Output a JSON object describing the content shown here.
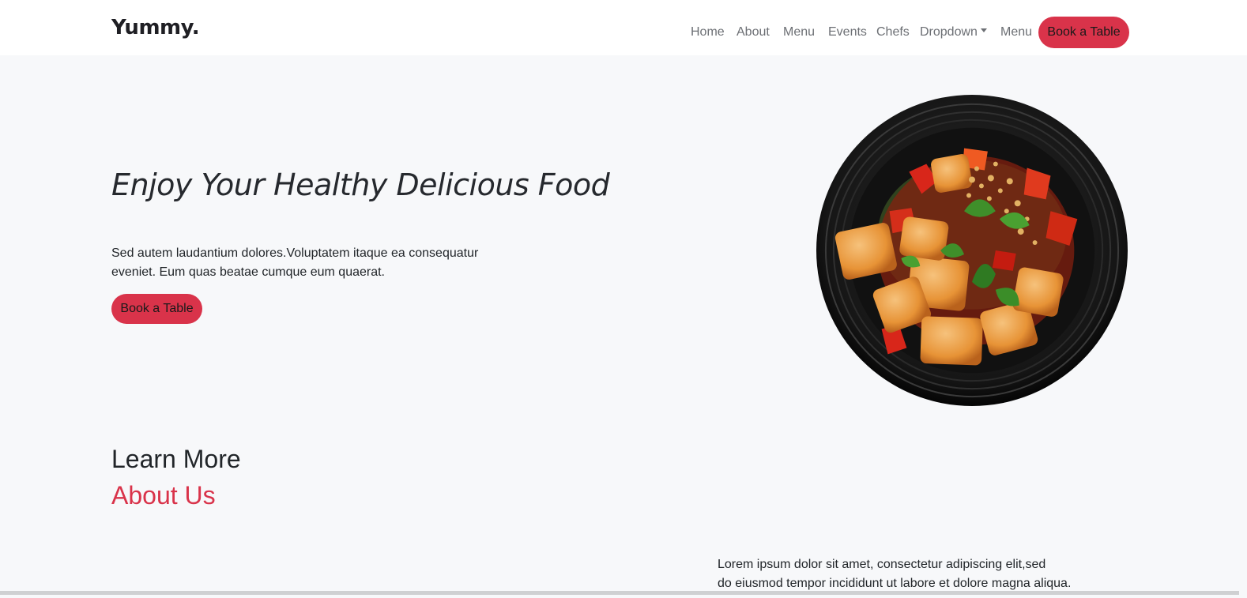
{
  "navbar": {
    "brand": "Yummy.",
    "links": [
      {
        "label": "Home"
      },
      {
        "label": "About"
      },
      {
        "label": "Menu"
      },
      {
        "label": "Events"
      },
      {
        "label": "Chefs"
      },
      {
        "label": "Dropdown"
      },
      {
        "label": "Menu"
      }
    ],
    "cta_label": "Book a Table"
  },
  "hero": {
    "title": "Enjoy Your Healthy Delicious Food",
    "text": "Sed autem laudantium dolores.Voluptatem itaque ea consequatur eveniet. Eum quas beatae cumque eum quaerat.",
    "cta_label": "Book a Table",
    "image_icon": "food-plate-image"
  },
  "about": {
    "kicker": "Learn More",
    "heading": "About Us",
    "paragraph_lines": [
      "Lorem ipsum dolor sit amet, consectetur adipiscing elit,sed",
      "do eiusmod tempor incididunt ut labore et dolore magna aliqua."
    ]
  },
  "colors": {
    "accent": "#d9334a",
    "background": "#f7f8fa",
    "navbar": "#ffffff",
    "text": "#212529",
    "nav_link": "#6c6f74"
  }
}
